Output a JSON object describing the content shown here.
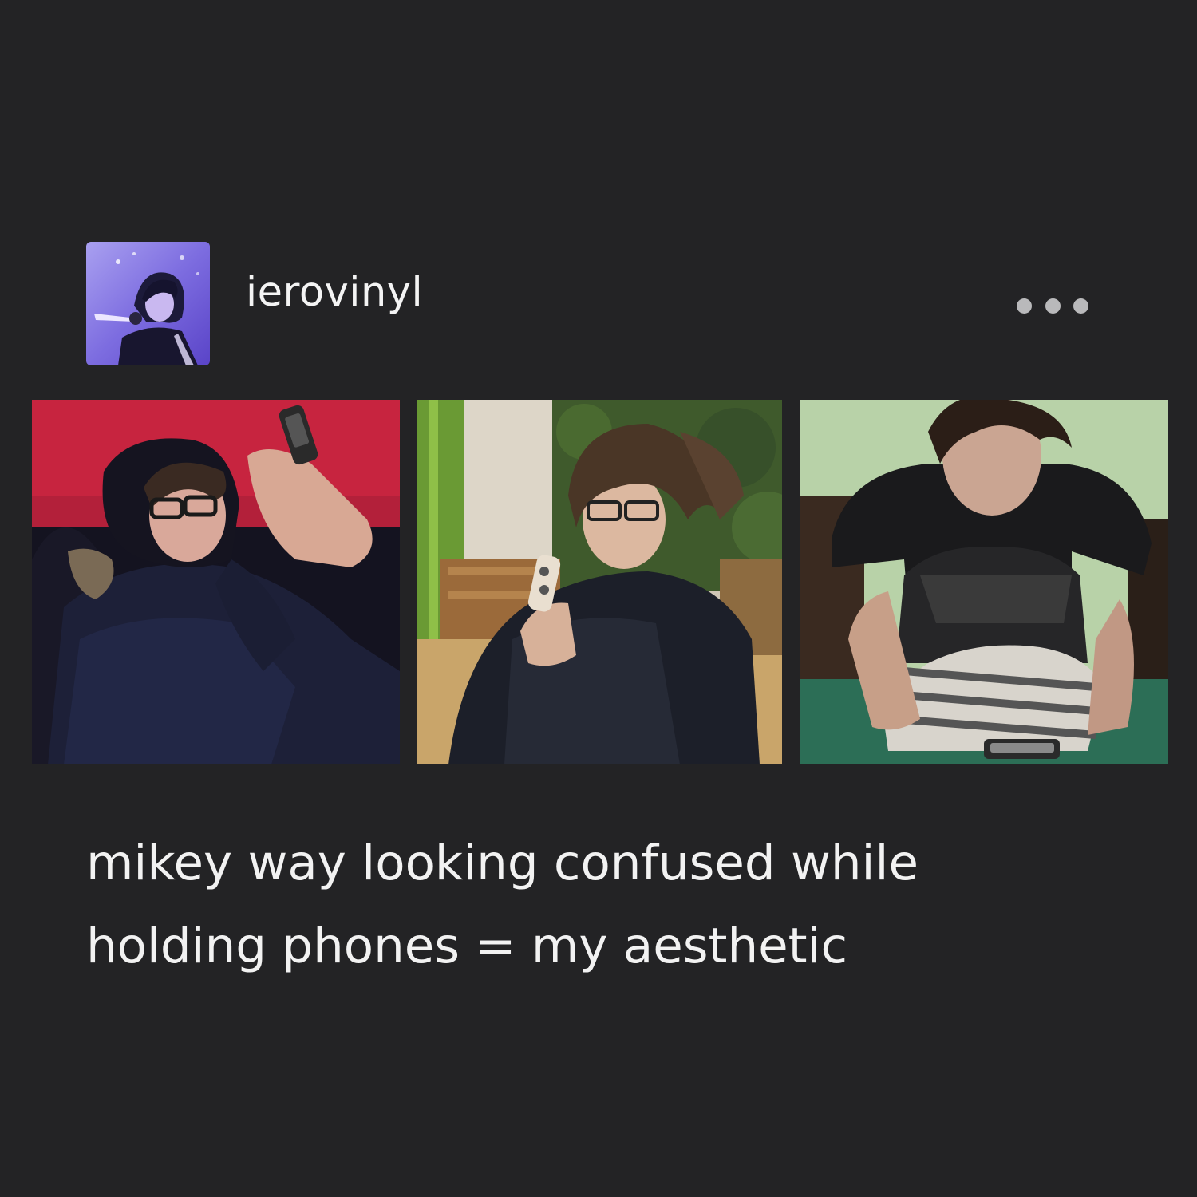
{
  "post": {
    "author": {
      "username": "ierovinyl",
      "avatar_icon": "avatar-photo"
    },
    "menu": {
      "icon": "more-options-icon"
    },
    "photos": [
      {
        "icon": "photo-person-phone-red-wall"
      },
      {
        "icon": "photo-person-phone-garden"
      },
      {
        "icon": "photo-person-phone-green-wall"
      }
    ],
    "caption": {
      "line1": "mikey way looking confused while",
      "line2": "holding phones = my aesthetic"
    }
  },
  "colors": {
    "background": "#232325",
    "text": "#f2f2f2",
    "menu_dots": "#b9b9bb"
  }
}
